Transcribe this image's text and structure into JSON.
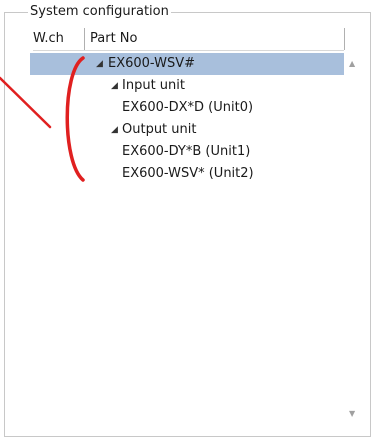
{
  "group": {
    "title": "System configuration"
  },
  "columns": {
    "wch": "W.ch",
    "part_no": "Part No"
  },
  "tree": [
    {
      "label": "EX600-WSV#",
      "expander": "◢",
      "selected": true
    },
    {
      "label": "Input unit",
      "expander": "◢",
      "selected": false
    },
    {
      "label": "EX600-DX*D (Unit0)",
      "expander": "",
      "selected": false
    },
    {
      "label": "Output unit",
      "expander": "◢",
      "selected": false
    },
    {
      "label": "EX600-DY*B (Unit1)",
      "expander": "",
      "selected": false
    },
    {
      "label": "EX600-WSV* (Unit2)",
      "expander": "",
      "selected": false
    }
  ],
  "scrollbar": {
    "up_icon": "▲",
    "down_icon": "▼"
  },
  "colors": {
    "selection": "#a8bfdc",
    "annotation": "#e02020"
  },
  "icons": {
    "expander": "triangle-expanded-icon",
    "scroll_up": "scroll-up-arrow-icon",
    "scroll_down": "scroll-down-arrow-icon"
  }
}
